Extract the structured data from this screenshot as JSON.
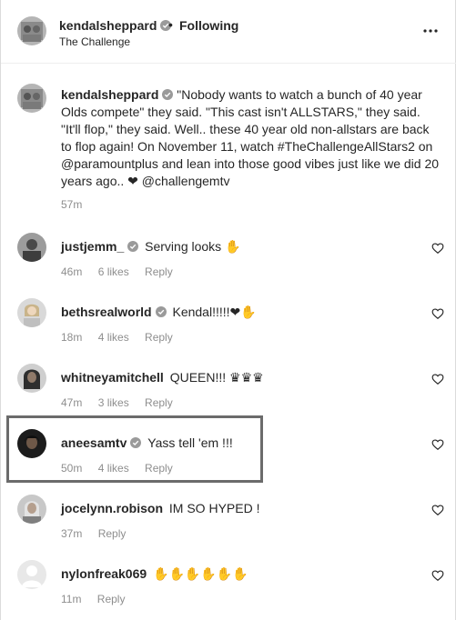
{
  "header": {
    "username": "kendalsheppard",
    "separator": "•",
    "follow_status": "Following",
    "subtitle": "The Challenge",
    "more_icon": "more-horizontal-icon"
  },
  "caption": {
    "username": "kendalsheppard",
    "text": "\"Nobody wants to watch a bunch of 40 year Olds compete\" they said. \"This cast isn't ALLSTARS,\" they said. \"It'll flop,\" they said. Well.. these 40 year old non-allstars are back to flop again! On November 11, watch #TheChallengeAllStars2 on @paramountplus and lean into those good vibes just like we did 20 years ago.. ❤ @challengemtv",
    "time": "57m"
  },
  "comments": [
    {
      "username": "justjemm_",
      "verified": true,
      "text": "Serving looks ✋",
      "time": "46m",
      "likes": "6 likes",
      "reply": "Reply"
    },
    {
      "username": "bethsrealworld",
      "verified": true,
      "text": "Kendal!!!!!❤✋",
      "time": "18m",
      "likes": "4 likes",
      "reply": "Reply"
    },
    {
      "username": "whitneyamitchell",
      "verified": false,
      "text": "QUEEN!!! ♛♛♛",
      "time": "47m",
      "likes": "3 likes",
      "reply": "Reply"
    },
    {
      "username": "aneesamtv",
      "verified": true,
      "text": "Yass tell 'em !!!",
      "time": "50m",
      "likes": "4 likes",
      "reply": "Reply"
    },
    {
      "username": "jocelynn.robison",
      "verified": false,
      "text": "IM SO HYPED !",
      "time": "37m",
      "likes": "",
      "reply": "Reply"
    },
    {
      "username": "nylonfreak069",
      "verified": false,
      "text": "✋✋✋✋✋✋",
      "time": "11m",
      "likes": "",
      "reply": "Reply"
    }
  ],
  "colors": {
    "text": "#262626",
    "secondary": "#8e8e8e",
    "verified": "#9a9a9a",
    "highlight_border": "#6b6b6b"
  }
}
